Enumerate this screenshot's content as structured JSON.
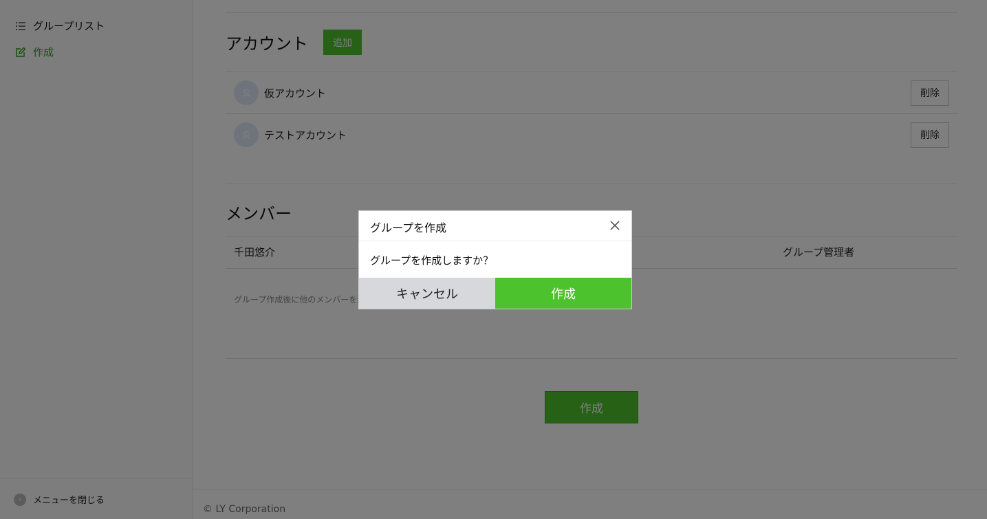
{
  "sidebar": {
    "items": [
      {
        "label": "グループリスト",
        "icon": "list-icon"
      },
      {
        "label": "作成",
        "icon": "edit-icon"
      }
    ],
    "close_menu_label": "メニューを閉じる"
  },
  "accounts": {
    "title": "アカウント",
    "add_label": "追加",
    "rows": [
      {
        "name": "仮アカウント",
        "delete_label": "削除"
      },
      {
        "name": "テストアカウント",
        "delete_label": "削除"
      }
    ]
  },
  "members": {
    "title": "メンバー",
    "rows": [
      {
        "name": "千田悠介",
        "role": "グループ管理者"
      }
    ],
    "note": "グループ作成後に他のメンバーを追"
  },
  "create_button_label": "作成",
  "footer": {
    "copyright": "© LY Corporation"
  },
  "modal": {
    "title": "グループを作成",
    "message": "グループを作成しますか？",
    "cancel_label": "キャンセル",
    "confirm_label": "作成"
  },
  "colors": {
    "accent": "#4cc32c",
    "overlay": "rgba(0,0,0,0.5)"
  }
}
